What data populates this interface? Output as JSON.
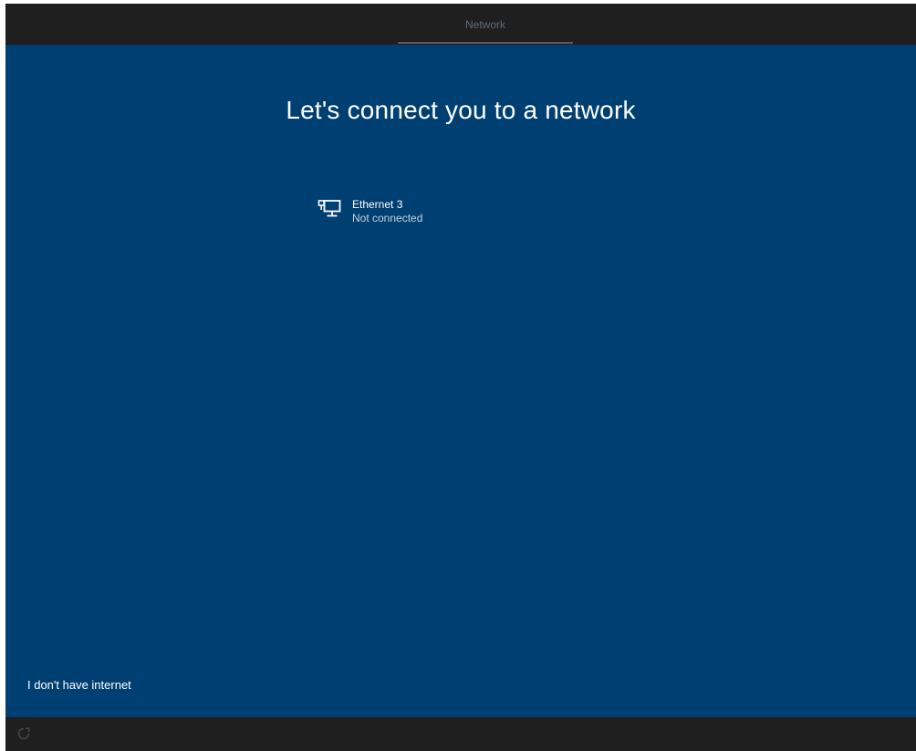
{
  "topbar": {
    "tab_label": "Network"
  },
  "main": {
    "title": "Let's connect you to a network",
    "network": {
      "name": "Ethernet 3",
      "status": "Not connected",
      "icon": "ethernet-icon"
    },
    "no_internet_label": "I don't have internet"
  },
  "bottombar": {
    "icon": "accessibility-icon"
  },
  "colors": {
    "background": "#003f71",
    "chrome": "#1f1f1f",
    "text": "#ffffff",
    "secondary_text": "#c7d4df"
  }
}
